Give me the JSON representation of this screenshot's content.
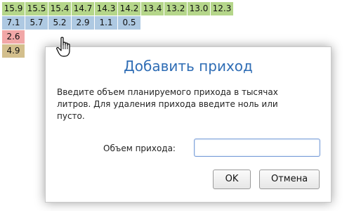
{
  "grid": {
    "row0": [
      "15.9",
      "15.5",
      "15.4",
      "14.7",
      "14.3",
      "14.2",
      "13.4",
      "13.2",
      "13.0",
      "12.3"
    ],
    "row1": [
      "7.1",
      "5.7",
      "5.2",
      "2.9",
      "1.1",
      "0.5"
    ],
    "row2": [
      "2.6"
    ],
    "row3": [
      "4.9"
    ]
  },
  "colors": {
    "green": "#b5d68a",
    "blue": "#aec9e2",
    "pink": "#f1a7a7",
    "tan": "#d3bf8d",
    "title": "#2f6db5"
  },
  "dialog": {
    "title": "Добавить приход",
    "text": "Введите объем планируемого прихода в тысячах литров. Для удаления прихода введите ноль или пусто.",
    "field_label": "Объем прихода:",
    "field_value": "",
    "ok_label": "OK",
    "cancel_label": "Отмена"
  },
  "cursor": {
    "icon": "hand-pointer-icon"
  }
}
